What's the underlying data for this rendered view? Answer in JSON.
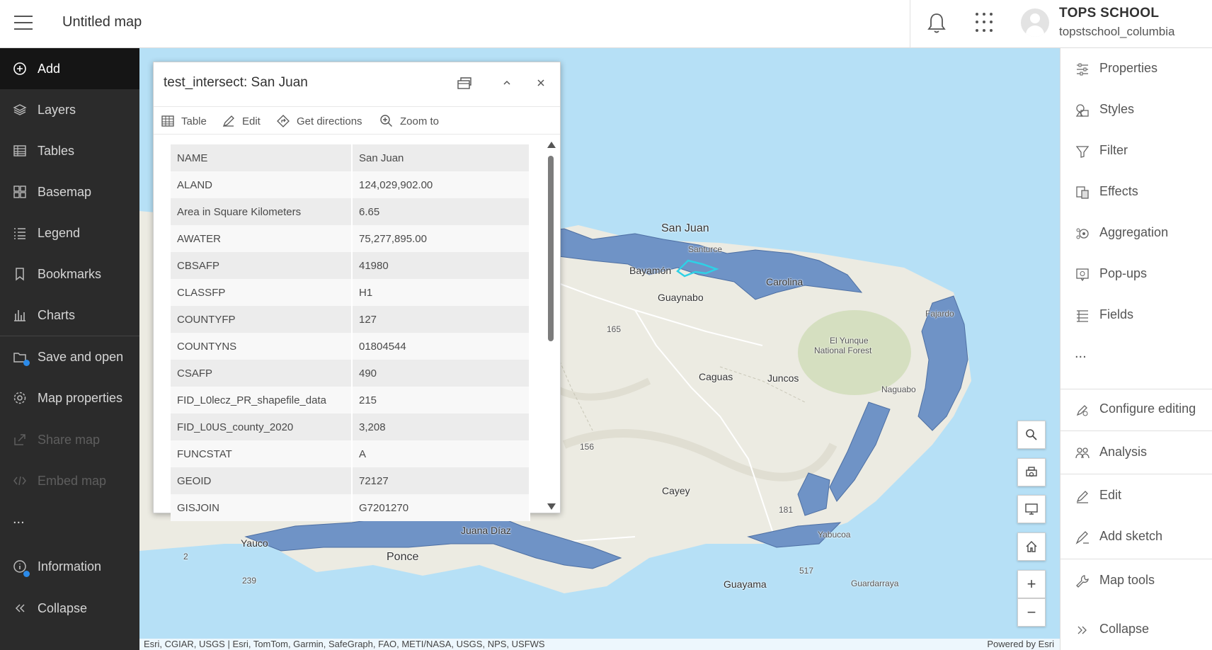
{
  "header": {
    "title": "Untitled map",
    "user_name": "TOPS SCHOOL",
    "user_handle": "topstschool_columbia"
  },
  "left_nav": {
    "items": [
      {
        "label": "Add",
        "icon": "plus-circle-icon"
      },
      {
        "label": "Layers",
        "icon": "layers-icon"
      },
      {
        "label": "Tables",
        "icon": "table-icon"
      },
      {
        "label": "Basemap",
        "icon": "basemap-icon"
      },
      {
        "label": "Legend",
        "icon": "legend-icon"
      },
      {
        "label": "Bookmarks",
        "icon": "bookmark-icon"
      },
      {
        "label": "Charts",
        "icon": "chart-icon"
      },
      {
        "label": "Save and open",
        "icon": "save-icon"
      },
      {
        "label": "Map properties",
        "icon": "gear-icon"
      },
      {
        "label": "Share map",
        "icon": "share-icon"
      },
      {
        "label": "Embed map",
        "icon": "code-icon"
      },
      {
        "label": "...",
        "icon": "ellipsis-icon"
      },
      {
        "label": "Information",
        "icon": "info-icon"
      },
      {
        "label": "Collapse",
        "icon": "chevrons-left-icon"
      }
    ]
  },
  "popup": {
    "title": "test_intersect: San Juan",
    "toolbar": [
      "Table",
      "Edit",
      "Get directions",
      "Zoom to"
    ],
    "attributes": [
      {
        "key": "NAME",
        "value": "San Juan"
      },
      {
        "key": "ALAND",
        "value": "124,029,902.00"
      },
      {
        "key": "Area in Square Kilometers",
        "value": "6.65"
      },
      {
        "key": "AWATER",
        "value": "75,277,895.00"
      },
      {
        "key": "CBSAFP",
        "value": "41980"
      },
      {
        "key": "CLASSFP",
        "value": "H1"
      },
      {
        "key": "COUNTYFP",
        "value": "127"
      },
      {
        "key": "COUNTYNS",
        "value": "01804544"
      },
      {
        "key": "CSAFP",
        "value": "490"
      },
      {
        "key": "FID_L0lecz_PR_shapefile_data",
        "value": "215"
      },
      {
        "key": "FID_L0US_county_2020",
        "value": "3,208"
      },
      {
        "key": "FUNCSTAT",
        "value": "A"
      },
      {
        "key": "GEOID",
        "value": "72127"
      },
      {
        "key": "GISJOIN",
        "value": "G7201270"
      }
    ]
  },
  "map": {
    "labels": [
      "San Juan",
      "Santurce",
      "Bayamón",
      "Carolina",
      "Guaynabo",
      "Fajardo",
      "El Yunque",
      "National Forest",
      "Caguas",
      "Juncos",
      "Naguabo",
      "Cayey",
      "Juana Díaz",
      "Yauco",
      "Ponce",
      "Guayama",
      "Guardarraya",
      "Yabucoa",
      "165",
      "156",
      "181",
      "2",
      "239",
      "517"
    ],
    "attribution": "Esri, CGIAR, USGS | Esri, TomTom, Garmin, SafeGraph, FAO, METI/NASA, USGS, NPS, USFWS",
    "powered_by": "Powered by Esri",
    "colors": {
      "water": "#b6e0f6",
      "land": "#ecebe2",
      "overlay": "#6f93c6",
      "selection": "#2ed1e6"
    }
  },
  "right_nav": {
    "items": [
      {
        "label": "Properties",
        "icon": "sliders-icon"
      },
      {
        "label": "Styles",
        "icon": "styles-icon"
      },
      {
        "label": "Filter",
        "icon": "filter-icon"
      },
      {
        "label": "Effects",
        "icon": "effects-icon"
      },
      {
        "label": "Aggregation",
        "icon": "aggregation-icon"
      },
      {
        "label": "Pop-ups",
        "icon": "popup-icon"
      },
      {
        "label": "Fields",
        "icon": "fields-icon"
      },
      {
        "label": "...",
        "icon": "ellipsis-icon"
      },
      {
        "label": "Configure editing",
        "icon": "configure-edit-icon"
      },
      {
        "label": "Analysis",
        "icon": "analysis-icon"
      },
      {
        "label": "Edit",
        "icon": "edit-icon"
      },
      {
        "label": "Add sketch",
        "icon": "sketch-icon"
      },
      {
        "label": "Map tools",
        "icon": "wrench-icon"
      },
      {
        "label": "Collapse",
        "icon": "chevrons-right-icon"
      }
    ]
  }
}
